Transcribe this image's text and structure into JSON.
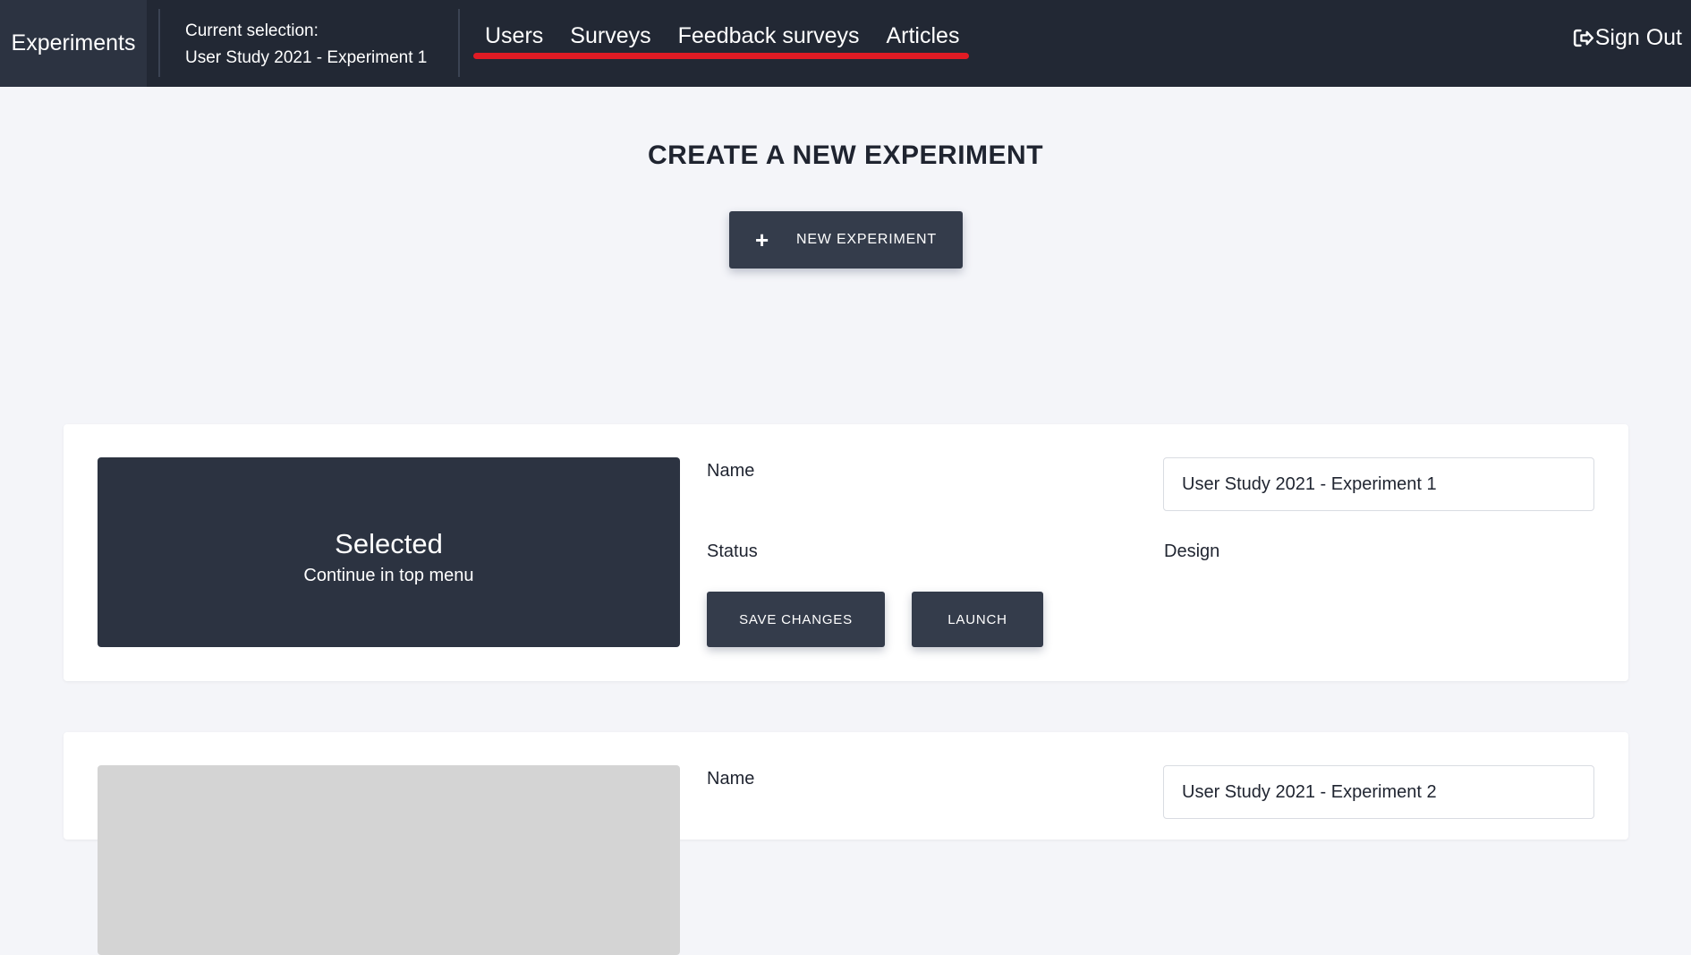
{
  "navbar": {
    "brand": "Experiments",
    "selection_label": "Current selection:",
    "selection_value": "User Study 2021 - Experiment 1",
    "links": [
      "Users",
      "Surveys",
      "Feedback surveys",
      "Articles"
    ],
    "underline_color": "#e01b24",
    "signout_label": "Sign Out",
    "signout_icon": "sign-out-icon"
  },
  "main": {
    "title": "CREATE A NEW EXPERIMENT",
    "new_button_label": "NEW EXPERIMENT",
    "new_button_icon": "plus-icon"
  },
  "experiments": [
    {
      "thumb_title": "Selected",
      "thumb_subtitle": "Continue in top menu",
      "name_label": "Name",
      "name_value": "User Study 2021 - Experiment 1",
      "status_label": "Status",
      "design_label": "Design",
      "save_label": "SAVE CHANGES",
      "launch_label": "LAUNCH"
    },
    {
      "name_label": "Name",
      "name_value": "User Study 2021 - Experiment 2"
    }
  ],
  "colors": {
    "navbar_bg": "#222834",
    "button_bg": "#343c4b",
    "page_bg": "#f4f5f9"
  }
}
